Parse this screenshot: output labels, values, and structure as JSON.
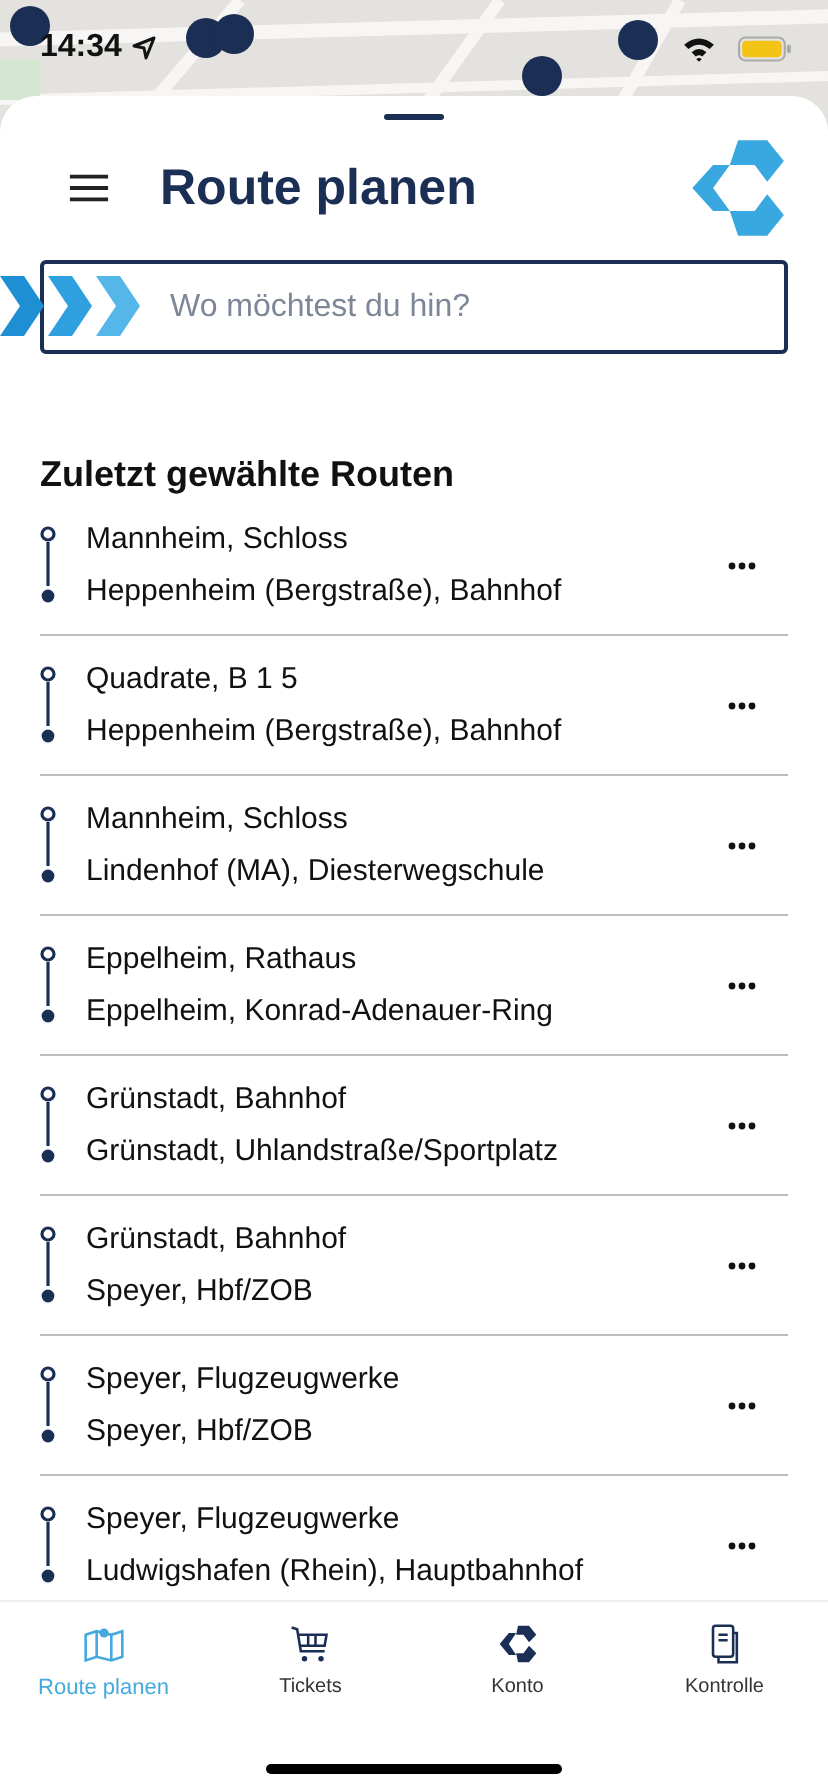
{
  "status_bar": {
    "time": "14:34"
  },
  "header": {
    "title": "Route planen"
  },
  "search": {
    "placeholder": "Wo möchtest du hin?"
  },
  "recent": {
    "title": "Zuletzt gewählte Routen",
    "routes": [
      {
        "from": "Mannheim, Schloss",
        "to": "Heppenheim (Bergstraße), Bahnhof"
      },
      {
        "from": "Quadrate, B 1 5",
        "to": "Heppenheim (Bergstraße), Bahnhof"
      },
      {
        "from": "Mannheim, Schloss",
        "to": "Lindenhof (MA), Diesterwegschule"
      },
      {
        "from": "Eppelheim, Rathaus",
        "to": "Eppelheim, Konrad-Adenauer-Ring"
      },
      {
        "from": "Grünstadt, Bahnhof",
        "to": "Grünstadt, Uhlandstraße/Sportplatz"
      },
      {
        "from": "Grünstadt, Bahnhof",
        "to": "Speyer, Hbf/ZOB"
      },
      {
        "from": "Speyer, Flugzeugwerke",
        "to": "Speyer, Hbf/ZOB"
      },
      {
        "from": "Speyer, Flugzeugwerke",
        "to": "Ludwigshafen (Rhein), Hauptbahnhof"
      }
    ]
  },
  "tab_bar": [
    {
      "label": "Route planen",
      "kind": "map",
      "selected": true
    },
    {
      "label": "Tickets",
      "kind": "cart",
      "selected": false
    },
    {
      "label": "Konto",
      "kind": "account",
      "selected": false
    },
    {
      "label": "Kontrolle",
      "kind": "phone",
      "selected": false
    }
  ]
}
